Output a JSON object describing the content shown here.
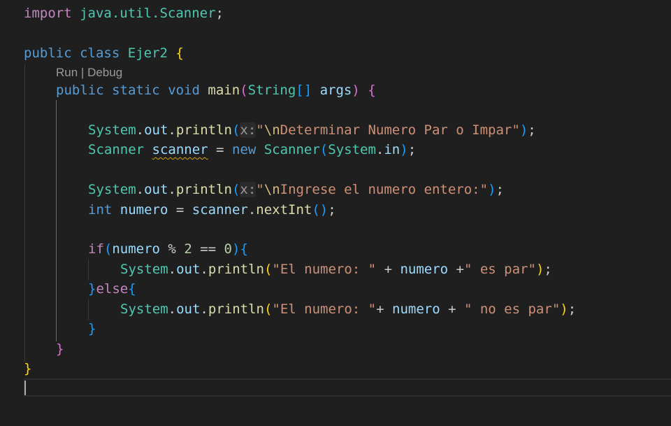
{
  "editor": {
    "language": "java",
    "file_class": "Ejer2",
    "codelens": {
      "run": "Run",
      "separator": " | ",
      "debug": "Debug"
    },
    "lines": {
      "l1": {
        "kw": "import",
        "rest": " java.util.Scanner",
        "semi": ";"
      },
      "l3": {
        "kw1": "public",
        "kw2": "class",
        "name": "Ejer2",
        "brace": "{"
      },
      "l5": {
        "kw1": "public",
        "kw2": "static",
        "kw3": "void",
        "fn": "main",
        "p1": "(",
        "ty": "String",
        "br": "[]",
        "arg": "args",
        "p2": ")",
        "brace": "{"
      },
      "l7": {
        "cls": "System",
        "dot1": ".",
        "fld": "out",
        "dot2": ".",
        "fn": "println",
        "p1": "(",
        "hint": "x:",
        "q1": "\"",
        "esc": "\\n",
        "str": "Determinar Numero Par o Impar\"",
        "p2": ")",
        "semi": ";"
      },
      "l8": {
        "ty": "Scanner",
        "var": "scanner",
        "eq": " = ",
        "kw": "new",
        "ty2": "Scanner",
        "p1": "(",
        "cls": "System",
        "dot": ".",
        "fld": "in",
        "p2": ")",
        "semi": ";"
      },
      "l10": {
        "cls": "System",
        "dot1": ".",
        "fld": "out",
        "dot2": ".",
        "fn": "println",
        "p1": "(",
        "hint": "x:",
        "q1": "\"",
        "esc": "\\n",
        "str": "Ingrese el numero entero:\"",
        "p2": ")",
        "semi": ";"
      },
      "l11": {
        "kw": "int",
        "var": "numero",
        "eq": " = ",
        "obj": "scanner",
        "dot": ".",
        "fn": "nextInt",
        "p": "()",
        "semi": ";"
      },
      "l13": {
        "kw": "if",
        "p1": "(",
        "var": "numero",
        "op": " % ",
        "n1": "2",
        "op2": " == ",
        "n2": "0",
        "p2": ")",
        "brace": "{"
      },
      "l14": {
        "cls": "System",
        "dot1": ".",
        "fld": "out",
        "dot2": ".",
        "fn": "println",
        "p1": "(",
        "s1": "\"El numero: \"",
        "op1": " + ",
        "var": "numero",
        "op2": " +",
        "s2": "\" es par\"",
        "p2": ")",
        "semi": ";"
      },
      "l15": {
        "brace1": "}",
        "kw": "else",
        "brace2": "{"
      },
      "l16": {
        "cls": "System",
        "dot1": ".",
        "fld": "out",
        "dot2": ".",
        "fn": "println",
        "p1": "(",
        "s1": "\"El numero: \"",
        "op1": "+ ",
        "var": "numero",
        "op2": " + ",
        "s2": "\" no es par\"",
        "p2": ")",
        "semi": ";"
      },
      "l17": {
        "brace": "}"
      },
      "l18": {
        "brace": "}"
      },
      "l19": {
        "brace": "}"
      }
    }
  }
}
